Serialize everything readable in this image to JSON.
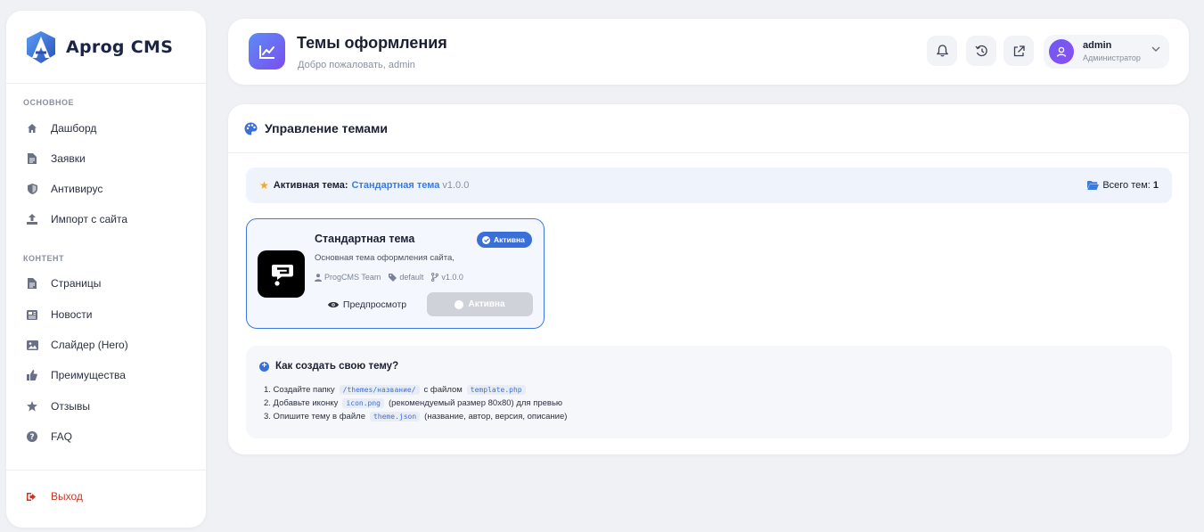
{
  "sidebar": {
    "brand": "Aprog CMS",
    "section_main": "ОСНОВНОЕ",
    "section_content": "КОНТЕНТ",
    "items": [
      {
        "label": "Дашборд",
        "icon": "home-icon"
      },
      {
        "label": "Заявки",
        "icon": "document-icon"
      },
      {
        "label": "Антивирус",
        "icon": "shield-icon"
      },
      {
        "label": "Импорт с сайта",
        "icon": "upload-icon"
      },
      {
        "label": "Страницы",
        "icon": "file-icon"
      },
      {
        "label": "Новости",
        "icon": "newspaper-icon"
      },
      {
        "label": "Слайдер (Hero)",
        "icon": "image-icon"
      },
      {
        "label": "Преимущества",
        "icon": "thumbs-up-icon"
      },
      {
        "label": "Отзывы",
        "icon": "star-icon"
      },
      {
        "label": "FAQ",
        "icon": "question-icon"
      }
    ],
    "logout": "Выход"
  },
  "header": {
    "title": "Темы оформления",
    "subtitle": "Добро пожаловать, admin",
    "user": {
      "name": "admin",
      "role": "Администратор"
    }
  },
  "main": {
    "title": "Управление темами",
    "active_bar": {
      "label": "Активная тема:",
      "theme": "Стандартная тема",
      "version": "v1.0.0",
      "total_label": "Всего тем:",
      "total_count": "1"
    },
    "theme_card": {
      "name": "Стандартная тема",
      "badge": "Активна",
      "description": "Основная тема оформления сайта,",
      "author": "ProgCMS Team",
      "slug": "default",
      "version": "v1.0.0",
      "preview_button": "Предпросмотр",
      "active_button": "Активна"
    },
    "howto": {
      "title": "Как создать свою тему?",
      "step1_a": "1. Создайте папку",
      "step1_code1": "/themes/название/",
      "step1_b": "с файлом",
      "step1_code2": "template.php",
      "step2_a": "2. Добавьте иконку",
      "step2_code": "icon.png",
      "step2_b": "(рекомендуемый размер 80x80) для превью",
      "step3_a": "3. Опишите тему в файле",
      "step3_code": "theme.json",
      "step3_b": "(название, автор, версия, описание)"
    }
  },
  "colors": {
    "accent": "#3b6fd8",
    "brand_gradient_start": "#5b8cf5",
    "brand_gradient_end": "#7b4ef0",
    "logout": "#c0392b",
    "background": "#f0f1f5"
  }
}
